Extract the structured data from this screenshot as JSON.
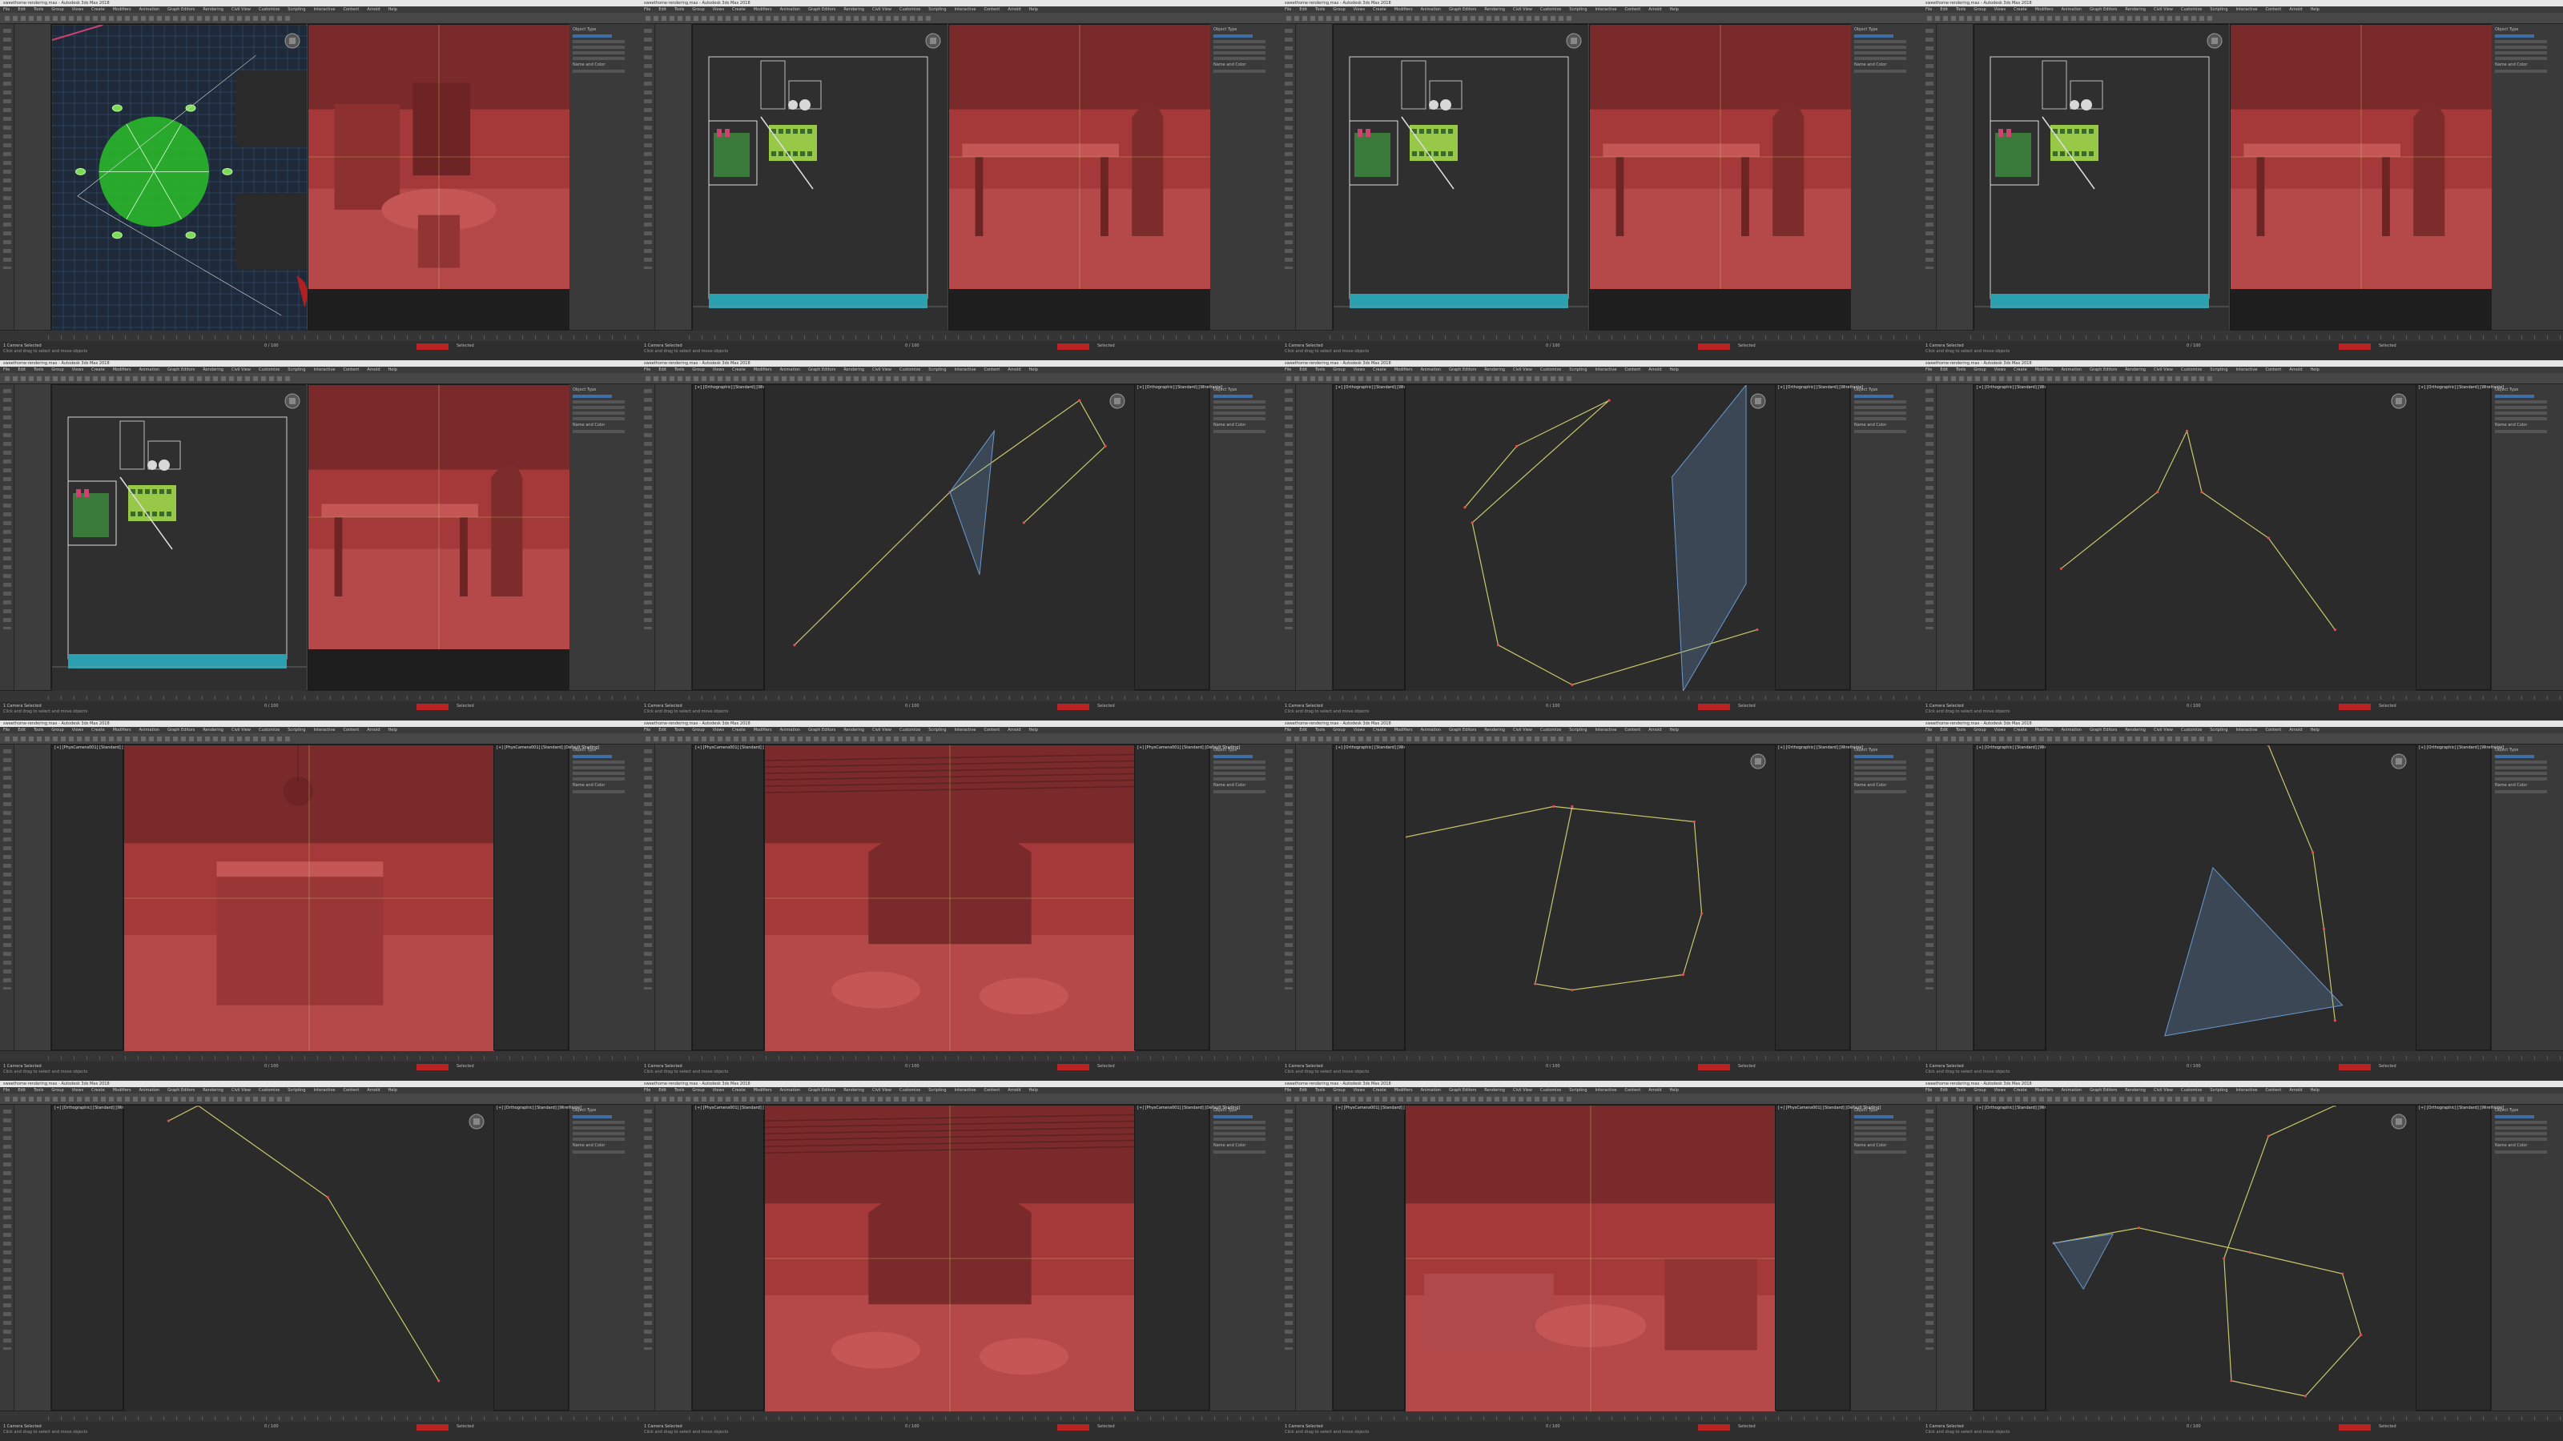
{
  "app": {
    "window_title": "sweethome-rendering.max - Autodesk 3ds Max 2018",
    "menu": [
      "File",
      "Edit",
      "Tools",
      "Group",
      "Views",
      "Create",
      "Modifiers",
      "Animation",
      "Graph Editors",
      "Rendering",
      "Civil View",
      "Customize",
      "Scripting",
      "Interactive",
      "Content",
      "Arnold",
      "Help"
    ],
    "workspace_label": "Workspaces: Default"
  },
  "viewport_labels": {
    "top": "[+] [Top] [Standard] [Wireframe]",
    "perspective": "[+] [PhysCamera001] [Standard] [Default Shading]",
    "orthographic": "[+] [Orthographic] [Standard] [Wireframe]"
  },
  "command_panel": {
    "section": "Object Type",
    "rollout": "Name and Color",
    "buttons": [
      "Box",
      "Cone",
      "Sphere",
      "GeoSphere",
      "Cylinder",
      "Tube",
      "Torus",
      "Pyramid",
      "Teapot",
      "Plane"
    ]
  },
  "status": {
    "selected": "1 Camera Selected",
    "prompt": "Click and drag to select and move objects",
    "frame": "0 / 100",
    "auto_key": "Auto Key",
    "selected_set": "Selected"
  },
  "colors": {
    "viewport_red": "#a53838",
    "spline_yellow": "#c8c86a",
    "camera_blue": "#6a9ad0",
    "selection_green": "#7cdc5a",
    "accent_blue": "#3f6fa8"
  },
  "tiles": [
    {
      "id": "t01",
      "kind": "top-split"
    },
    {
      "id": "t02",
      "kind": "plan-split"
    },
    {
      "id": "t03",
      "kind": "plan-split"
    },
    {
      "id": "t04",
      "kind": "plan-split"
    },
    {
      "id": "t05",
      "kind": "plan-split"
    },
    {
      "id": "t06",
      "kind": "path"
    },
    {
      "id": "t07",
      "kind": "path"
    },
    {
      "id": "t08",
      "kind": "path"
    },
    {
      "id": "t09",
      "kind": "render"
    },
    {
      "id": "t10",
      "kind": "render"
    },
    {
      "id": "t11",
      "kind": "path"
    },
    {
      "id": "t12",
      "kind": "path"
    },
    {
      "id": "t13",
      "kind": "path"
    },
    {
      "id": "t14",
      "kind": "render"
    },
    {
      "id": "t15",
      "kind": "render"
    },
    {
      "id": "t16",
      "kind": "path"
    }
  ]
}
